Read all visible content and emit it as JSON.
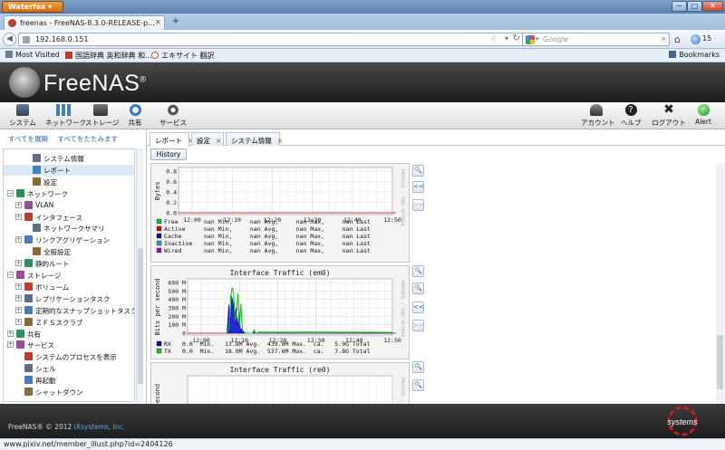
{
  "browser": {
    "app_button": "Waterfox",
    "tab_title": "freenas - FreeNAS-8.3.0-RELEASE-p...",
    "new_tab": "+",
    "url": "192.168.0.151",
    "search_placeholder": "Google",
    "extension_count": "15",
    "bookmarks": [
      "Most Visited",
      "国語辞典 英和辞典 和...",
      "エキサイト 翻訳"
    ],
    "bookmarks_menu": "Bookmarks",
    "status_url": "www.pixiv.net/member_illust.php?id=2404126"
  },
  "app": {
    "logo": "FreeNAS",
    "logo_mark": "®",
    "toolbar_left": [
      "システム",
      "ネットワーク",
      "ストレージ",
      "共有",
      "サービス"
    ],
    "toolbar_right": [
      "アカウント",
      "ヘルプ",
      "ログアウト",
      "Alert"
    ],
    "footer": "FreeNAS® © 2012",
    "footer_link": "iXsystems, Inc.",
    "footer_logo_text": "systems"
  },
  "sidebar": {
    "expand_all": "すべてを展開",
    "collapse_all": "すべてをたたみます",
    "tree": [
      {
        "label": "システム情報",
        "level": 2,
        "exp": ""
      },
      {
        "label": "レポート",
        "level": 2,
        "exp": "",
        "selected": true
      },
      {
        "label": "設定",
        "level": 2,
        "exp": ""
      },
      {
        "label": "ネットワーク",
        "level": 0,
        "exp": "−"
      },
      {
        "label": "VLAN",
        "level": 1,
        "exp": "+"
      },
      {
        "label": "インタフェース",
        "level": 1,
        "exp": "+"
      },
      {
        "label": "ネットワークサマリ",
        "level": 2,
        "exp": ""
      },
      {
        "label": "リンクアグリゲーション",
        "level": 1,
        "exp": "+"
      },
      {
        "label": "全般設定",
        "level": 2,
        "exp": ""
      },
      {
        "label": "静的ルート",
        "level": 1,
        "exp": "+"
      },
      {
        "label": "ストレージ",
        "level": 0,
        "exp": "−"
      },
      {
        "label": "ボリューム",
        "level": 1,
        "exp": "+"
      },
      {
        "label": "レプリケーションタスク",
        "level": 1,
        "exp": "+"
      },
      {
        "label": "定期的なスナップショットタスク",
        "level": 1,
        "exp": "+"
      },
      {
        "label": "ＺＦＳスクラブ",
        "level": 1,
        "exp": "+"
      },
      {
        "label": "共有",
        "level": 0,
        "exp": "+"
      },
      {
        "label": "サービス",
        "level": 0,
        "exp": "+"
      },
      {
        "label": "システムのプロセスを表示",
        "level": 1,
        "exp": ""
      },
      {
        "label": "シェル",
        "level": 1,
        "exp": ""
      },
      {
        "label": "再起動",
        "level": 1,
        "exp": ""
      },
      {
        "label": "シャットダウン",
        "level": 1,
        "exp": ""
      }
    ]
  },
  "content": {
    "tabs": [
      "レポート",
      "設定",
      "システム情報"
    ],
    "tab_close": "×",
    "history_button": "History",
    "side_buttons": [
      "🔍",
      "<<",
      ">>"
    ],
    "rrd_credit": "PROTOCOL / TOBI OETIKER"
  },
  "colors": {
    "free": "#00cc00",
    "active": "#cc0000",
    "cache": "#0000cc",
    "inactive": "#00aaaa",
    "wired": "#aa00aa",
    "rx": "#0000cc",
    "tx": "#00cc00"
  },
  "chart_data": [
    {
      "type": "line",
      "ylabel": "Bytes",
      "x_ticks": [
        "12:00",
        "12:10",
        "12:20",
        "12:30",
        "12:40",
        "12:50"
      ],
      "y_ticks": [
        "0.8",
        "0.6",
        "0.4",
        "0.2",
        "0.0"
      ],
      "ylim": [
        0,
        0.8
      ],
      "legend": [
        {
          "name": "Free",
          "color": "#00cc00",
          "stats": "nan Min,     nan Avg,     nan Max,     nan Last"
        },
        {
          "name": "Active",
          "color": "#cc0000",
          "stats": "nan Min,     nan Avg,     nan Max,     nan Last"
        },
        {
          "name": "Cache",
          "color": "#0000cc",
          "stats": "nan Min,     nan Avg,     nan Max,     nan Last"
        },
        {
          "name": "Inactive",
          "color": "#00aaaa",
          "stats": "nan Min,     nan Avg,     nan Max,     nan Last"
        },
        {
          "name": "Wired",
          "color": "#aa00aa",
          "stats": "nan Min,     nan Avg,     nan Max,     nan Last"
        }
      ]
    },
    {
      "type": "line",
      "title": "Interface Traffic (em0)",
      "ylabel": "Bits per second",
      "x_ticks": [
        "12:00",
        "12:10",
        "12:20",
        "12:30",
        "12:40",
        "12:50"
      ],
      "y_ticks": [
        "600 M",
        "500 M",
        "400 M",
        "300 M",
        "200 M",
        "100 M",
        "0"
      ],
      "ylim": [
        0,
        600
      ],
      "series": [
        {
          "name": "RX",
          "color": "#0000cc",
          "x": [
            7.0,
            7.5,
            7.9,
            8.3,
            8.7,
            9.1,
            9.5,
            9.9,
            10.3,
            10.7,
            11.1,
            11.5,
            12.0,
            14.0,
            14.4,
            14.8,
            16.0,
            30.0,
            52.0
          ],
          "values": [
            0,
            340,
            110,
            439,
            360,
            200,
            300,
            80,
            250,
            30,
            60,
            10,
            0,
            0,
            40,
            0,
            0,
            0,
            0
          ],
          "legend": "0.0  Min.   13.8M Avg.  439.0M Max.  ca.   5.9G Total"
        },
        {
          "name": "TX",
          "color": "#00cc00",
          "x": [
            7.0,
            7.6,
            8.0,
            8.4,
            8.8,
            9.2,
            9.6,
            10.0,
            10.4,
            10.8,
            11.2,
            11.6,
            12.0,
            14.0,
            14.4,
            14.8,
            16.0,
            22.0,
            30.0,
            40.0,
            52.0
          ],
          "values": [
            0,
            60,
            420,
            537.6,
            480,
            150,
            230,
            470,
            90,
            350,
            40,
            20,
            0,
            0,
            35,
            0,
            15,
            12,
            15,
            12,
            10
          ],
          "legend": "0.0  Min.   18.0M Avg.  537.6M Max.  ca.   7.8G Total"
        }
      ]
    },
    {
      "type": "line",
      "title": "Interface Traffic (re0)",
      "ylabel": "per second"
    }
  ]
}
